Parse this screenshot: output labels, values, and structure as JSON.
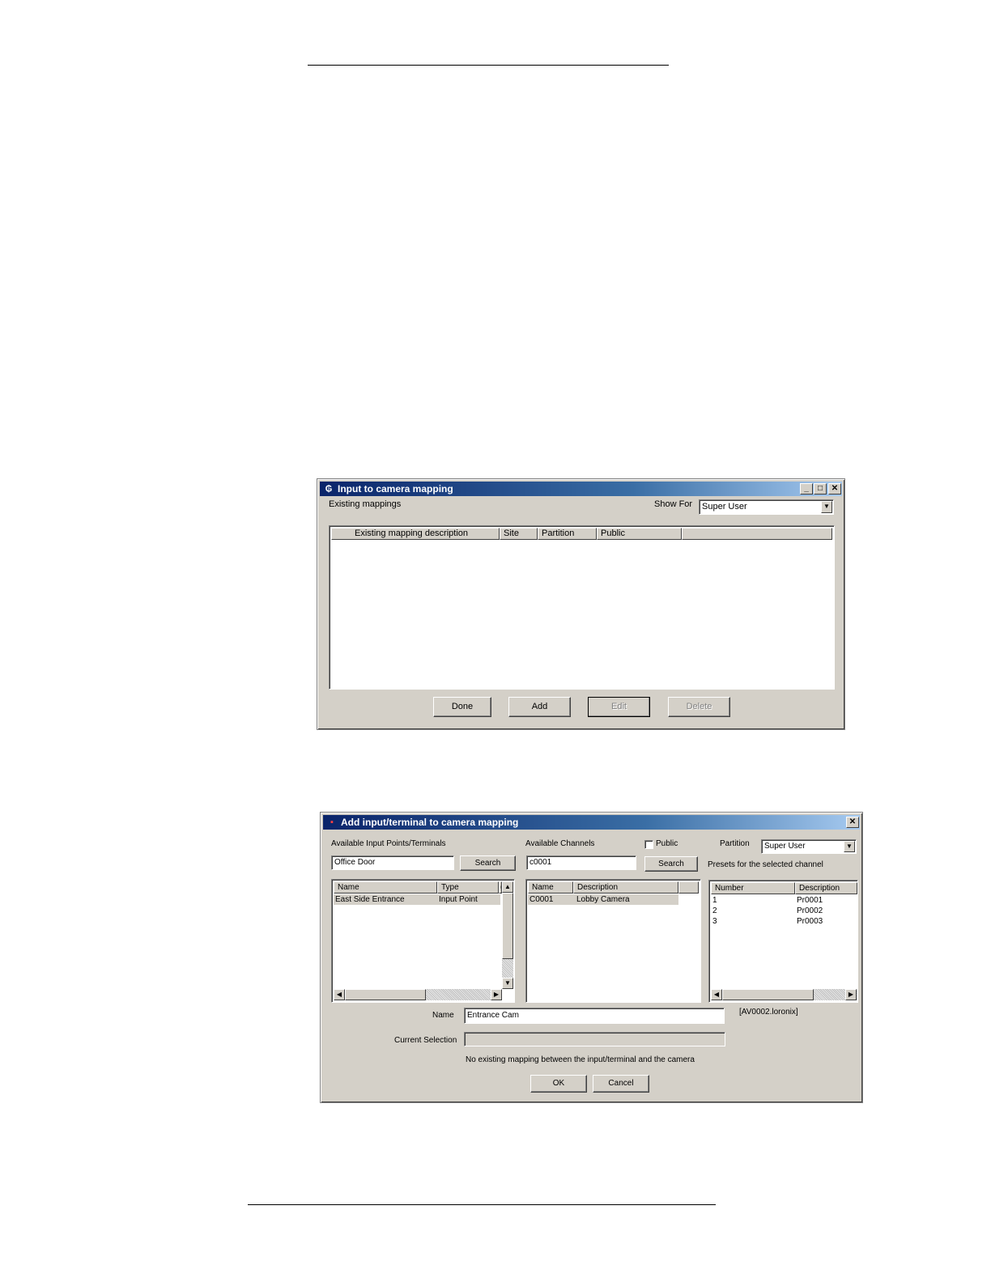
{
  "win1": {
    "title": "Input to camera mapping",
    "existing_label": "Existing mappings",
    "show_for_label": "Show For",
    "show_for_value": "Super User",
    "columns": [
      "Existing mapping description",
      "Site",
      "Partition",
      "Public"
    ],
    "buttons": {
      "done": "Done",
      "add": "Add",
      "edit": "Edit",
      "delete": "Delete"
    }
  },
  "win2": {
    "title": "Add input/terminal to camera mapping",
    "inputs_label": "Available Input Points/Terminals",
    "inputs_search_value": "Office Door",
    "search_label": "Search",
    "channels_label": "Available  Channels",
    "public_label": "Public",
    "partition_label": "Partition",
    "partition_value": "Super User",
    "channels_search_value": "c0001",
    "presets_label": "Presets for the selected channel",
    "inputs_table": {
      "columns": [
        "Name",
        "Type",
        "("
      ],
      "rows": [
        {
          "name": "East Side Entrance",
          "type": "Input Point"
        }
      ]
    },
    "channels_table": {
      "columns": [
        "Name",
        "Description"
      ],
      "rows": [
        {
          "name": "C0001",
          "description": "Lobby Camera"
        }
      ]
    },
    "presets_table": {
      "columns": [
        "Number",
        "Description"
      ],
      "rows": [
        {
          "number": "1",
          "description": "Pr0001"
        },
        {
          "number": "2",
          "description": "Pr0002"
        },
        {
          "number": "3",
          "description": "Pr0003"
        }
      ]
    },
    "name_label": "Name",
    "name_value": "Entrance Cam",
    "server_tag": "[AV0002.loronix]",
    "current_selection_label": "Current Selection",
    "current_selection_value": "",
    "status_message": "No existing mapping between the input/terminal and the camera",
    "ok_label": "OK",
    "cancel_label": "Cancel"
  }
}
